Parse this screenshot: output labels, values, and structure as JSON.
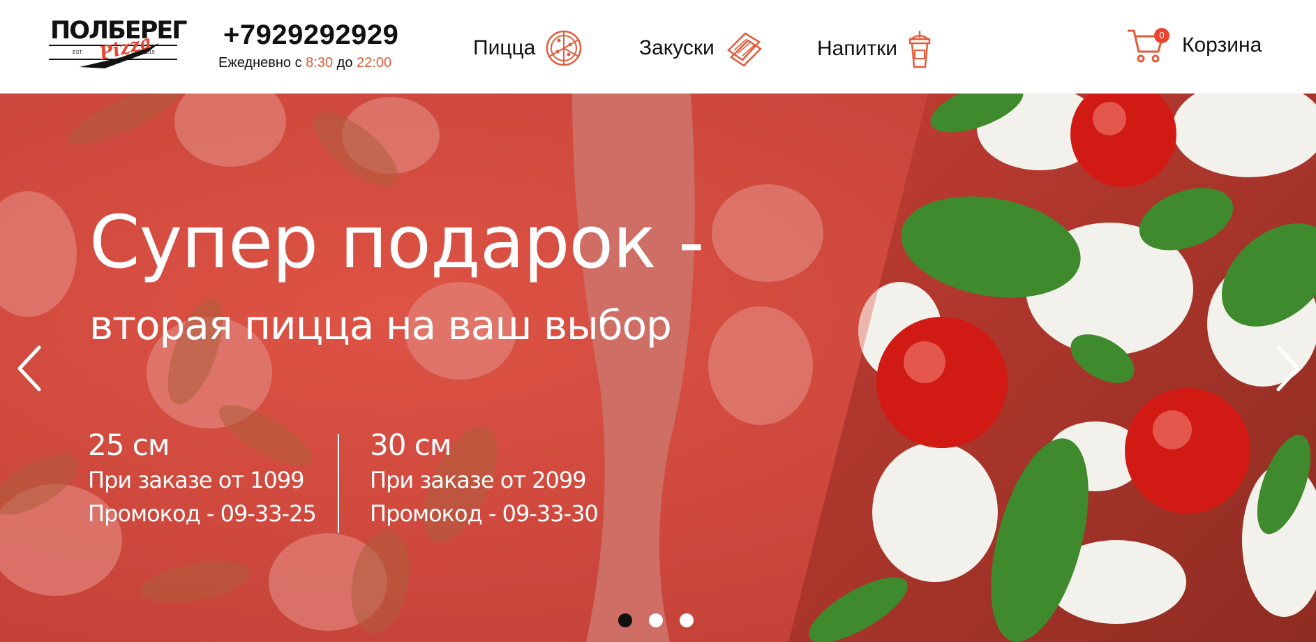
{
  "header": {
    "logo": {
      "name": "ПОЛБЕРЕГ",
      "script": "Pizza",
      "est": "EST.",
      "year": "2019"
    },
    "phone": "+7929292929",
    "hours": {
      "prefix": "Ежедневно с",
      "open": "8:30",
      "middle": "до",
      "close": "22:00"
    },
    "nav": [
      {
        "label": "Пицца",
        "icon": "pizza-icon"
      },
      {
        "label": "Закуски",
        "icon": "sandwich-icon"
      },
      {
        "label": "Напитки",
        "icon": "drink-cup-icon"
      }
    ],
    "cart": {
      "label": "Корзина",
      "count": "0",
      "icon": "cart-icon"
    }
  },
  "hero": {
    "title": "Супер подарок -",
    "subtitle": "вторая пицца на ваш выбор",
    "offers": [
      {
        "size": "25 см",
        "condition": "При заказе от 1099",
        "promo": "Промокод - 09-33-25"
      },
      {
        "size": "30 см",
        "condition": "При заказе от 2099",
        "promo": "Промокод - 09-33-30"
      }
    ],
    "slides": 3,
    "active_slide": 1
  },
  "colors": {
    "accent": "#e8442f",
    "overlay": "#d9483c",
    "text_dark": "#111111"
  }
}
